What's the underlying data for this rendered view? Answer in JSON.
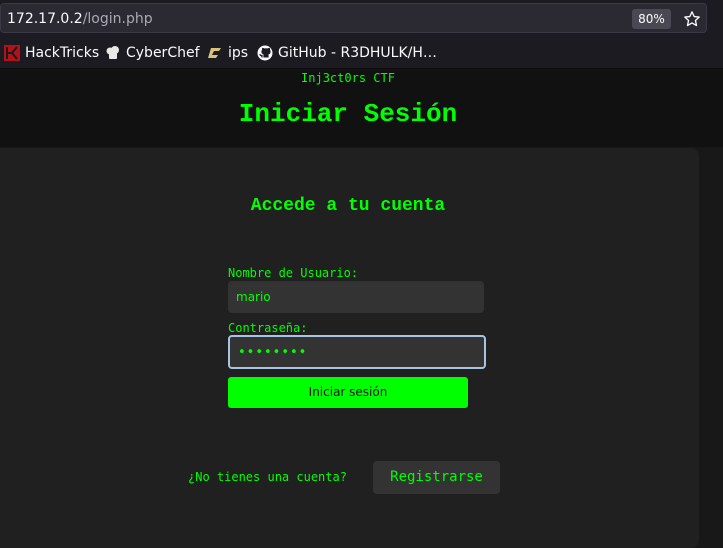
{
  "browser": {
    "url_host": "172.17.0.2",
    "url_path": "/login.php",
    "zoom": "80%",
    "bookmarks": [
      {
        "label": "HackTricks",
        "icon": "hacktricks-icon"
      },
      {
        "label": "CyberChef",
        "icon": "cyberchef-icon"
      },
      {
        "label": "ips",
        "icon": "ips-icon"
      },
      {
        "label": "GitHub - R3DHULK/H…",
        "icon": "github-icon"
      }
    ]
  },
  "page": {
    "brand": "Inj3ct0rs CTF",
    "title": "Iniciar Sesión",
    "card_heading": "Accede a tu cuenta",
    "username_label": "Nombre de Usuario:",
    "username_value": "mario",
    "password_label": "Contraseña:",
    "password_mask": "••••••••",
    "login_button": "Iniciar sesión",
    "signup_prompt": "¿No tienes una cuenta?",
    "signup_button": "Registrarse"
  },
  "colors": {
    "accent": "#00ff00",
    "background": "#181818",
    "card": "#202020",
    "input": "#333333",
    "focus_ring": "#a7c4e3"
  }
}
